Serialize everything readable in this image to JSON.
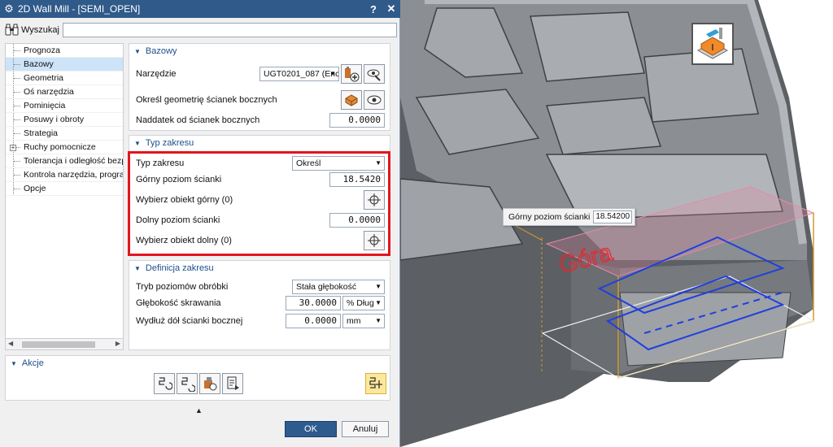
{
  "window": {
    "title": "2D Wall Mill - [SEMI_OPEN]",
    "help": "?",
    "close": "✕"
  },
  "search": {
    "label": "Wyszukaj",
    "value": ""
  },
  "tree": {
    "items": [
      {
        "label": "Prognoza",
        "selected": false,
        "expandable": false
      },
      {
        "label": "Bazowy",
        "selected": true,
        "expandable": false
      },
      {
        "label": "Geometria",
        "selected": false,
        "expandable": false
      },
      {
        "label": "Oś narzędzia",
        "selected": false,
        "expandable": false
      },
      {
        "label": "Pominięcia",
        "selected": false,
        "expandable": false
      },
      {
        "label": "Posuwy i obroty",
        "selected": false,
        "expandable": false
      },
      {
        "label": "Strategia",
        "selected": false,
        "expandable": false
      },
      {
        "label": "Ruchy pomocnicze",
        "selected": false,
        "expandable": true
      },
      {
        "label": "Tolerancja i odległość bezp",
        "selected": false,
        "expandable": false
      },
      {
        "label": "Kontrola narzędzia, prograr",
        "selected": false,
        "expandable": false
      },
      {
        "label": "Opcje",
        "selected": false,
        "expandable": false
      }
    ]
  },
  "bazowy": {
    "header": "Bazowy",
    "tool_label": "Narzędzie",
    "tool_value": "UGT0201_087 (Enc",
    "walls_label": "Określ geometrię ścianek bocznych",
    "allowance_label": "Naddatek od ścianek bocznych",
    "allowance_value": "0.0000"
  },
  "typ_zakresu": {
    "header": "Typ zakresu",
    "type_label": "Typ zakresu",
    "type_value": "Określ",
    "top_label": "Górny poziom ścianki",
    "top_value": "18.5420",
    "select_top_label": "Wybierz obiekt górny (0)",
    "bottom_label": "Dolny poziom ścianki",
    "bottom_value": "0.0000",
    "select_bottom_label": "Wybierz obiekt dolny (0)"
  },
  "definicja": {
    "header": "Definicja zakresu",
    "levels_label": "Tryb poziomów obróbki",
    "levels_value": "Stała głębokość",
    "depth_label": "Głębokość skrawania",
    "depth_value": "30.0000",
    "depth_unit": "% Dług",
    "extend_label": "Wydłuż dół ścianki bocznej",
    "extend_value": "0.0000",
    "extend_unit": "mm"
  },
  "akcje": {
    "header": "Akcje"
  },
  "buttons": {
    "ok": "OK",
    "cancel": "Anuluj"
  },
  "viewport": {
    "callout_label": "Górny poziom ścianki",
    "callout_value": "18.54200",
    "surface_label": "Góra"
  },
  "colors": {
    "title_bar": "#2f5a8a",
    "highlight_box": "#e3151e",
    "toolpath": "#1f3fe0",
    "wall_boundary": "#d49a2a",
    "top_plane": "#e58aa6"
  },
  "icons": {
    "gear": "gear-icon",
    "search": "binoculars-icon",
    "tool_new": "new-tool-icon",
    "display": "eye-icon",
    "walls": "wall-geometry-icon",
    "point": "point-constructor-icon",
    "operation_type": "wall-mill-operation-icon"
  }
}
